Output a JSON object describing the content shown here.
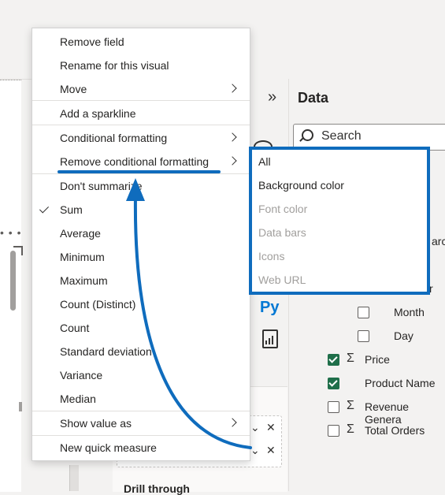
{
  "data_pane": {
    "title": "Data",
    "search_placeholder": "Search",
    "partial_label_1": "arc",
    "partial_label_2": "r",
    "fields": [
      {
        "label": "Month",
        "checked": false,
        "sigma": false
      },
      {
        "label": "Day",
        "checked": false,
        "sigma": false
      },
      {
        "label": "Price",
        "checked": true,
        "sigma": true
      },
      {
        "label": "Product Name",
        "checked": true,
        "sigma": false
      },
      {
        "label": "Revenue Genera",
        "checked": false,
        "sigma": true
      },
      {
        "label": "Total Orders",
        "checked": false,
        "sigma": true
      }
    ]
  },
  "viz_pane": {
    "python_visual_label": "Py",
    "drill_through_label": "Drill through"
  },
  "context_menu": {
    "items": [
      {
        "label": "Remove field"
      },
      {
        "label": "Rename for this visual"
      },
      {
        "label": "Move"
      },
      {
        "label": "Add a sparkline"
      },
      {
        "label": "Conditional formatting"
      },
      {
        "label": "Remove conditional formatting"
      },
      {
        "label": "Don't summarize"
      },
      {
        "label": "Sum"
      },
      {
        "label": "Average"
      },
      {
        "label": "Minimum"
      },
      {
        "label": "Maximum"
      },
      {
        "label": "Count (Distinct)"
      },
      {
        "label": "Count"
      },
      {
        "label": "Standard deviation"
      },
      {
        "label": "Variance"
      },
      {
        "label": "Median"
      },
      {
        "label": "Show value as"
      },
      {
        "label": "New quick measure"
      }
    ]
  },
  "submenu": {
    "items": [
      {
        "label": "All",
        "enabled": true
      },
      {
        "label": "Background color",
        "enabled": true
      },
      {
        "label": "Font color",
        "enabled": false
      },
      {
        "label": "Data bars",
        "enabled": false
      },
      {
        "label": "Icons",
        "enabled": false
      },
      {
        "label": "Web URL",
        "enabled": false
      }
    ]
  },
  "icons": {
    "expand": "double-chevron-right-icon",
    "search": "search-icon",
    "chevron": "chevron-right-icon",
    "check": "checkmark-icon",
    "close": "close-icon",
    "dropdown": "chevron-down-icon",
    "sigma": "sigma-icon"
  },
  "colors": {
    "highlight": "#0f6cbd",
    "checked_box": "#1f6f4a",
    "disabled_text": "#a19f9d"
  }
}
